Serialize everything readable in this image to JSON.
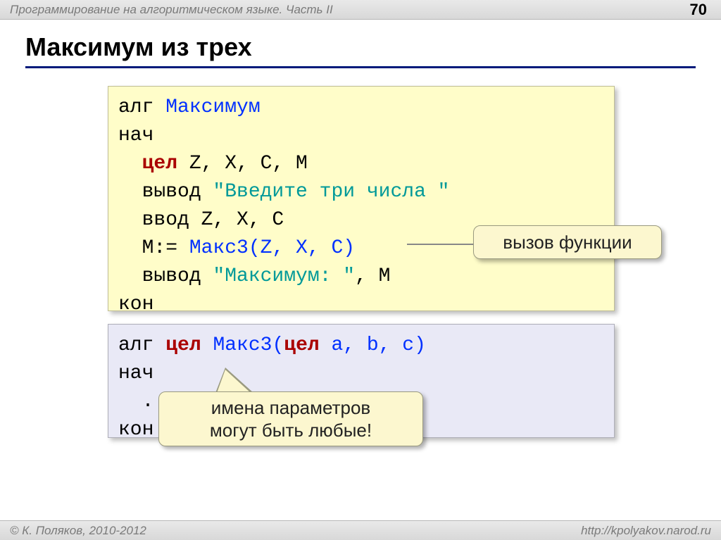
{
  "header": {
    "chapter": "Программирование на алгоритмическом языке. Часть II",
    "page": "70"
  },
  "title": "Максимум из трех",
  "code1": {
    "t1a": "алг ",
    "t1b": "Максимум",
    "t2": "нач",
    "t3a": "  ",
    "t3b": "цел",
    "t3c": " Z, X, C, M",
    "t4a": "  вывод ",
    "t4b": "\"Введите три числа \"",
    "t5": "  ввод Z, X, C",
    "t6a": "  M:= ",
    "t6b": "Макс3(Z, X, C)",
    "t7a": "  вывод ",
    "t7b": "\"Максимум: \"",
    "t7c": ", M",
    "t8": "кон"
  },
  "code2": {
    "t1a": "алг ",
    "t1b": "цел ",
    "t1c": "Макс3(",
    "t1d": "цел",
    "t1e": " a, b, c)",
    "t2": "нач",
    "t3": "  ...",
    "t4": "кон"
  },
  "callouts": {
    "func": "вызов функции",
    "params": "имена параметров\nмогут быть любые!"
  },
  "footer": {
    "copyright": "© К. Поляков, 2010-2012",
    "url": "http://kpolyakov.narod.ru"
  }
}
